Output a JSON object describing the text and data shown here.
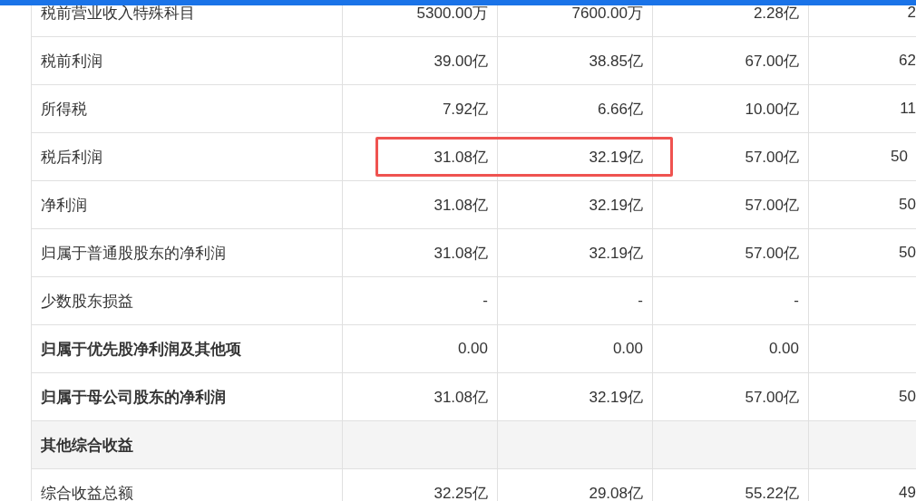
{
  "rows": [
    {
      "label": "税前营业收入特殊科目",
      "kind": "normal",
      "highlighted": false,
      "values": [
        "5300.00万",
        "7600.00万",
        "2.28亿",
        "2"
      ]
    },
    {
      "label": "税前利润",
      "kind": "normal",
      "highlighted": false,
      "values": [
        "39.00亿",
        "38.85亿",
        "67.00亿",
        "62"
      ]
    },
    {
      "label": "所得税",
      "kind": "normal",
      "highlighted": false,
      "values": [
        "7.92亿",
        "6.66亿",
        "10.00亿",
        "11"
      ]
    },
    {
      "label": "税后利润",
      "kind": "normal",
      "highlighted": true,
      "values": [
        "31.08亿",
        "32.19亿",
        "57.00亿",
        "50"
      ]
    },
    {
      "label": "净利润",
      "kind": "normal",
      "highlighted": false,
      "values": [
        "31.08亿",
        "32.19亿",
        "57.00亿",
        "50"
      ]
    },
    {
      "label": "归属于普通股股东的净利润",
      "kind": "normal",
      "highlighted": false,
      "values": [
        "31.08亿",
        "32.19亿",
        "57.00亿",
        "50"
      ]
    },
    {
      "label": "少数股东损益",
      "kind": "normal",
      "highlighted": false,
      "values": [
        "-",
        "-",
        "-"
      ]
    },
    {
      "label": "归属于优先股净利润及其他项",
      "kind": "bold",
      "highlighted": false,
      "values": [
        "0.00",
        "0.00",
        "0.00"
      ]
    },
    {
      "label": "归属于母公司股东的净利润",
      "kind": "bold",
      "highlighted": false,
      "values": [
        "31.08亿",
        "32.19亿",
        "57.00亿",
        "50"
      ]
    },
    {
      "label": "其他综合收益",
      "kind": "section",
      "highlighted": false
    },
    {
      "label": "综合收益总额",
      "kind": "normal",
      "highlighted": false,
      "values": [
        "32.25亿",
        "29.08亿",
        "55.22亿",
        "49"
      ]
    }
  ]
}
